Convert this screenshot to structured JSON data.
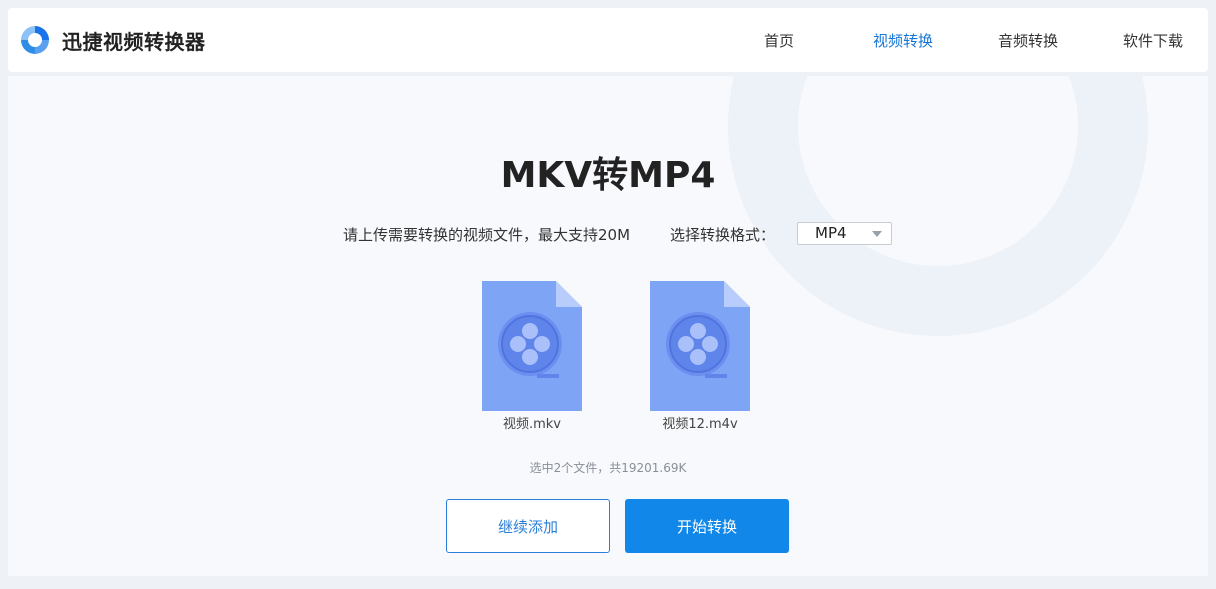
{
  "app": {
    "title": "迅捷视频转换器"
  },
  "nav": {
    "items": [
      {
        "label": "首页"
      },
      {
        "label": "视频转换"
      },
      {
        "label": "音频转换"
      },
      {
        "label": "软件下载"
      }
    ]
  },
  "main": {
    "title": "MKV转MP4",
    "upload_hint": "请上传需要转换的视频文件，最大支持20M",
    "format_label": "选择转换格式：",
    "format_value": "MP4",
    "files": [
      {
        "name": "视频.mkv"
      },
      {
        "name": "视频12.m4v"
      }
    ],
    "summary": "选中2个文件，共19201.69K",
    "add_button": "继续添加",
    "start_button": "开始转换"
  },
  "colors": {
    "accent": "#1187ea",
    "nav_active": "#1677d8",
    "file_icon": "#7aa2f7"
  }
}
